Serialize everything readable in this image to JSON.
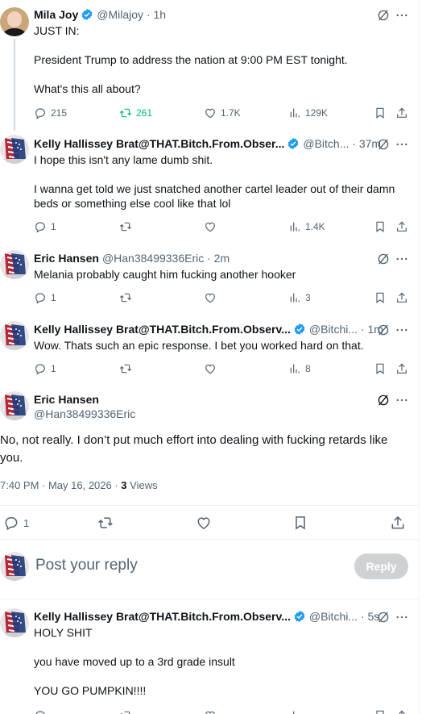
{
  "tweet1": {
    "name": "Mila Joy",
    "meta": "@Milajoy · 1h",
    "body": "JUST IN:\n\nPresident Trump to address the nation at 9:00 PM EST tonight.\n\nWhat's this all about?",
    "replies": "215",
    "reposts": "261",
    "likes": "1.7K",
    "views": "129K"
  },
  "tweet2": {
    "name": "Kelly Hallissey Brat@THAT.Bitch.From.Obser...",
    "meta": "@Bitch... · 37m",
    "body": "I hope this isn't any lame dumb shit.\n\nI wanna get told we just snatched another cartel leader out of their damn beds or something else cool like that lol",
    "replies": "1",
    "views": "1.4K"
  },
  "tweet3": {
    "name": "Eric Hansen",
    "meta": "@Han38499336Eric · 2m",
    "body": "Melania probably caught him fucking another hooker",
    "replies": "1",
    "views": "3"
  },
  "tweet4": {
    "name": "Kelly Hallissey Brat@THAT.Bitch.From.Observ...",
    "meta": "@Bitchi... · 1m",
    "body": "Wow.  Thats such an epic response.  I bet you worked hard on that.",
    "replies": "1",
    "views": "8"
  },
  "main": {
    "name": "Eric Hansen",
    "handle": "@Han38499336Eric",
    "body": "No, not really. I don’t put much effort into dealing with fucking retards like you.",
    "timestamp": "7:40 PM · May 16, 2026 · ",
    "views_count": "3",
    "views_label": " Views",
    "replies": "1"
  },
  "reply_box": {
    "placeholder": "Post your reply",
    "button": "Reply"
  },
  "tweet5": {
    "name": "Kelly Hallissey Brat@THAT.Bitch.From.Observ...",
    "meta": "@Bitchi... · 5s",
    "body": "HOLY SHIT\n\nyou have moved up to a 3rd grade insult\n\nYOU GO PUMPKIN!!!!"
  },
  "colors": {
    "accent": "#1d9bf0",
    "repost_green": "#00ba7c",
    "secondary_text": "#536471",
    "reply_button_bg": "#cfd2d5"
  }
}
